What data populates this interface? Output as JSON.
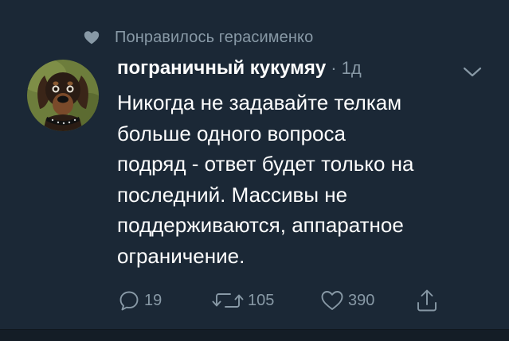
{
  "social_context": {
    "icon": "heart-icon",
    "text": "Понравилось герасименко"
  },
  "tweet": {
    "author_name": "пограничный кукумяу",
    "separator": "·",
    "time": "1д",
    "text": "Никогда не задавайте телкам\nбольше одного вопроса\nподряд - ответ будет только на\nпоследний. Массивы не\nподдерживаются, аппаратное\nограничение.",
    "avatar": "dog-avatar",
    "menu_icon": "chevron-down-icon"
  },
  "actions": {
    "reply_count": "19",
    "retweet_count": "105",
    "like_count": "390"
  },
  "colors": {
    "background": "#1b2836",
    "secondary_text": "#8899a6",
    "primary_text": "#ffffff"
  }
}
